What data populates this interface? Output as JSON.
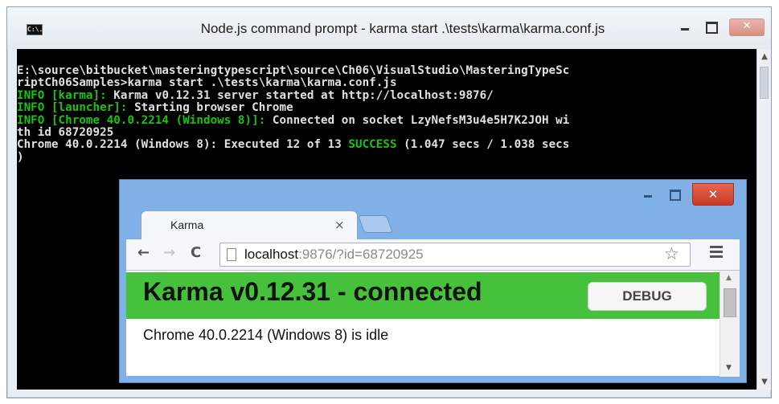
{
  "console_window": {
    "title": "Node.js command prompt - karma  start .\\tests\\karma\\karma.conf.js",
    "icon": "C:\\.",
    "lines": [
      [
        {
          "t": "E:\\source\\bitbucket\\masteringtypescript\\source\\Ch06\\VisualStudio\\MasteringTypeSc",
          "c": "w"
        }
      ],
      [
        {
          "t": "riptCh06Samples>karma start .\\tests\\karma\\karma.conf.js",
          "c": "w"
        }
      ],
      [
        {
          "t": "INFO [karma]: ",
          "c": "g"
        },
        {
          "t": "Karma v0.12.31 server started at http://localhost:9876/",
          "c": "w"
        }
      ],
      [
        {
          "t": "INFO [launcher]: ",
          "c": "g"
        },
        {
          "t": "Starting browser Chrome",
          "c": "w"
        }
      ],
      [
        {
          "t": "INFO [Chrome 40.0.2214 (Windows 8)]: ",
          "c": "g"
        },
        {
          "t": "Connected on socket LzyNefsM3u4e5H7K2JOH wi",
          "c": "w"
        }
      ],
      [
        {
          "t": "th id 68720925",
          "c": "w"
        }
      ],
      [
        {
          "t": "Chrome 40.0.2214 (Windows 8): Executed 12 of 13 ",
          "c": "w"
        },
        {
          "t": "SUCCESS",
          "c": "g"
        },
        {
          "t": " (1.047 secs / 1.038 secs",
          "c": "w"
        }
      ],
      [
        {
          "t": ")",
          "c": "w"
        }
      ]
    ]
  },
  "browser": {
    "tab_title": "Karma",
    "tab_close": "×",
    "url_host": "localhost",
    "url_rest": ":9876/?id=68720925",
    "banner_title": "Karma v0.12.31 - connected",
    "debug_label": "DEBUG",
    "status_text": "Chrome 40.0.2214 (Windows 8) is idle",
    "banner_color": "#46c13b",
    "close_glyph": "✕"
  },
  "colors": {
    "console_bg": "#000000",
    "console_text": "#e0e0e0",
    "console_green": "#16c60c"
  }
}
